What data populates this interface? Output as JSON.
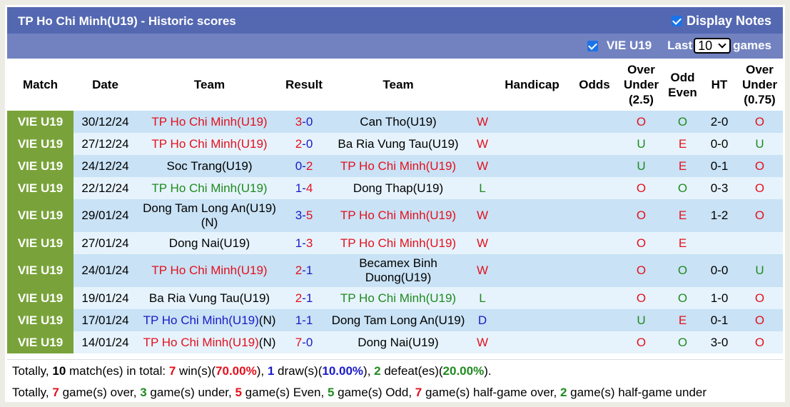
{
  "header": {
    "title": "TP Ho Chi Minh(U19) - Historic scores",
    "display_notes_label": "Display Notes",
    "display_notes_checked": true
  },
  "filter": {
    "league_label": "VIE U19",
    "league_checked": true,
    "last_label": "Last",
    "games_count": "10",
    "games_label": "games"
  },
  "columns": {
    "match": "Match",
    "date": "Date",
    "team": "Team",
    "result": "Result",
    "team2": "Team",
    "handicap": "Handicap",
    "odds": "Odds",
    "over_under_l1": "Over",
    "over_under_l2": "Under",
    "over_under_l3": "(2.5)",
    "odd_even_l1": "Odd",
    "odd_even_l2": "Even",
    "ht": "HT",
    "ou2_l1": "Over",
    "ou2_l2": "Under",
    "ou2_l3": "(0.75)"
  },
  "rows": [
    {
      "league": "VIE U19",
      "date": "30/12/24",
      "home": "TP Ho Chi Minh(U19)",
      "home_color": "red",
      "score_home": "3",
      "score_away": "0",
      "sh_color": "red",
      "sa_color": "blue",
      "away": "Can Tho(U19)",
      "away_color": "dk",
      "result": "W",
      "result_color": "red",
      "handicap": "",
      "odds": "",
      "ou": "O",
      "ou_color": "red",
      "oe": "O",
      "oe_color": "green",
      "ht": "2-0",
      "ou2": "O",
      "ou2_color": "red"
    },
    {
      "league": "VIE U19",
      "date": "27/12/24",
      "home": "TP Ho Chi Minh(U19)",
      "home_color": "red",
      "score_home": "2",
      "score_away": "0",
      "sh_color": "red",
      "sa_color": "blue",
      "away": "Ba Ria Vung Tau(U19)",
      "away_color": "dk",
      "result": "W",
      "result_color": "red",
      "handicap": "",
      "odds": "",
      "ou": "U",
      "ou_color": "green",
      "oe": "E",
      "oe_color": "red",
      "ht": "0-0",
      "ou2": "U",
      "ou2_color": "green"
    },
    {
      "league": "VIE U19",
      "date": "24/12/24",
      "home": "Soc Trang(U19)",
      "home_color": "dk",
      "score_home": "0",
      "score_away": "2",
      "sh_color": "blue",
      "sa_color": "red",
      "away": "TP Ho Chi Minh(U19)",
      "away_color": "red",
      "result": "W",
      "result_color": "red",
      "handicap": "",
      "odds": "",
      "ou": "U",
      "ou_color": "green",
      "oe": "E",
      "oe_color": "red",
      "ht": "0-1",
      "ou2": "O",
      "ou2_color": "red"
    },
    {
      "league": "VIE U19",
      "date": "22/12/24",
      "home": "TP Ho Chi Minh(U19)",
      "home_color": "green",
      "score_home": "1",
      "score_away": "4",
      "sh_color": "blue",
      "sa_color": "red",
      "away": "Dong Thap(U19)",
      "away_color": "dk",
      "result": "L",
      "result_color": "green",
      "handicap": "",
      "odds": "",
      "ou": "O",
      "ou_color": "red",
      "oe": "O",
      "oe_color": "green",
      "ht": "0-3",
      "ou2": "O",
      "ou2_color": "red"
    },
    {
      "league": "VIE U19",
      "date": "29/01/24",
      "home": "Dong Tam Long An(U19)(N)",
      "home_color": "dk",
      "score_home": "3",
      "score_away": "5",
      "sh_color": "blue",
      "sa_color": "red",
      "away": "TP Ho Chi Minh(U19)",
      "away_color": "red",
      "result": "W",
      "result_color": "red",
      "handicap": "",
      "odds": "",
      "ou": "O",
      "ou_color": "red",
      "oe": "E",
      "oe_color": "red",
      "ht": "1-2",
      "ou2": "O",
      "ou2_color": "red",
      "tall": true
    },
    {
      "league": "VIE U19",
      "date": "27/01/24",
      "home": "Dong Nai(U19)",
      "home_color": "dk",
      "score_home": "1",
      "score_away": "3",
      "sh_color": "blue",
      "sa_color": "red",
      "away": "TP Ho Chi Minh(U19)",
      "away_color": "red",
      "result": "W",
      "result_color": "red",
      "handicap": "",
      "odds": "",
      "ou": "O",
      "ou_color": "red",
      "oe": "E",
      "oe_color": "red",
      "ht": "",
      "ou2": "",
      "ou2_color": "red"
    },
    {
      "league": "VIE U19",
      "date": "24/01/24",
      "home": "TP Ho Chi Minh(U19)",
      "home_color": "red",
      "score_home": "2",
      "score_away": "1",
      "sh_color": "red",
      "sa_color": "blue",
      "away": "Becamex Binh Duong(U19)",
      "away_color": "dk",
      "result": "W",
      "result_color": "red",
      "handicap": "",
      "odds": "",
      "ou": "O",
      "ou_color": "red",
      "oe": "O",
      "oe_color": "green",
      "ht": "0-0",
      "ou2": "U",
      "ou2_color": "green",
      "tall": true
    },
    {
      "league": "VIE U19",
      "date": "19/01/24",
      "home": "Ba Ria Vung Tau(U19)",
      "home_color": "dk",
      "score_home": "2",
      "score_away": "1",
      "sh_color": "red",
      "sa_color": "blue",
      "away": "TP Ho Chi Minh(U19)",
      "away_color": "green",
      "result": "L",
      "result_color": "green",
      "handicap": "",
      "odds": "",
      "ou": "O",
      "ou_color": "red",
      "oe": "O",
      "oe_color": "green",
      "ht": "1-0",
      "ou2": "O",
      "ou2_color": "red"
    },
    {
      "league": "VIE U19",
      "date": "17/01/24",
      "home": "TP Ho Chi Minh(U19)",
      "home_suffix": "(N)",
      "home_color": "blue",
      "score_home": "1",
      "score_away": "1",
      "sh_color": "blue",
      "sa_color": "blue",
      "away": "Dong Tam Long An(U19)",
      "away_color": "dk",
      "result": "D",
      "result_color": "blue",
      "handicap": "",
      "odds": "",
      "ou": "U",
      "ou_color": "green",
      "oe": "E",
      "oe_color": "red",
      "ht": "0-1",
      "ou2": "O",
      "ou2_color": "red"
    },
    {
      "league": "VIE U19",
      "date": "14/01/24",
      "home": "TP Ho Chi Minh(U19)",
      "home_suffix": "(N)",
      "home_color": "red",
      "score_home": "7",
      "score_away": "0",
      "sh_color": "red",
      "sa_color": "blue",
      "away": "Dong Nai(U19)",
      "away_color": "dk",
      "result": "W",
      "result_color": "red",
      "handicap": "",
      "odds": "",
      "ou": "O",
      "ou_color": "red",
      "oe": "O",
      "oe_color": "green",
      "ht": "3-0",
      "ou2": "O",
      "ou2_color": "red"
    }
  ],
  "summary1": [
    {
      "t": "Totally, ",
      "c": ""
    },
    {
      "t": "10",
      "c": "dk"
    },
    {
      "t": " match(es) in total: ",
      "c": ""
    },
    {
      "t": "7",
      "c": "red"
    },
    {
      "t": " win(s)(",
      "c": ""
    },
    {
      "t": "70.00%",
      "c": "red"
    },
    {
      "t": "), ",
      "c": ""
    },
    {
      "t": "1",
      "c": "blue"
    },
    {
      "t": " draw(s)(",
      "c": ""
    },
    {
      "t": "10.00%",
      "c": "blue"
    },
    {
      "t": "), ",
      "c": ""
    },
    {
      "t": "2",
      "c": "green"
    },
    {
      "t": " defeat(es)(",
      "c": ""
    },
    {
      "t": "20.00%",
      "c": "green"
    },
    {
      "t": ").",
      "c": ""
    }
  ],
  "summary2": [
    {
      "t": "Totally, ",
      "c": ""
    },
    {
      "t": "7",
      "c": "red"
    },
    {
      "t": " game(s) over, ",
      "c": ""
    },
    {
      "t": "3",
      "c": "green"
    },
    {
      "t": " game(s) under, ",
      "c": ""
    },
    {
      "t": "5",
      "c": "red"
    },
    {
      "t": " game(s) Even, ",
      "c": ""
    },
    {
      "t": "5",
      "c": "green"
    },
    {
      "t": " game(s) Odd, ",
      "c": ""
    },
    {
      "t": "7",
      "c": "red"
    },
    {
      "t": " game(s) half-game over, ",
      "c": ""
    },
    {
      "t": "2",
      "c": "green"
    },
    {
      "t": " game(s) half-game under",
      "c": ""
    }
  ],
  "colors": {
    "title_bar": "#5468b2",
    "sub_bar": "#7282c0",
    "league_cell": "#79a33a",
    "row_a": "#c9e2f5",
    "row_b": "#e6f3fc",
    "red": "#e3101d",
    "blue": "#1a1ac8",
    "green": "#1f8a1f"
  }
}
